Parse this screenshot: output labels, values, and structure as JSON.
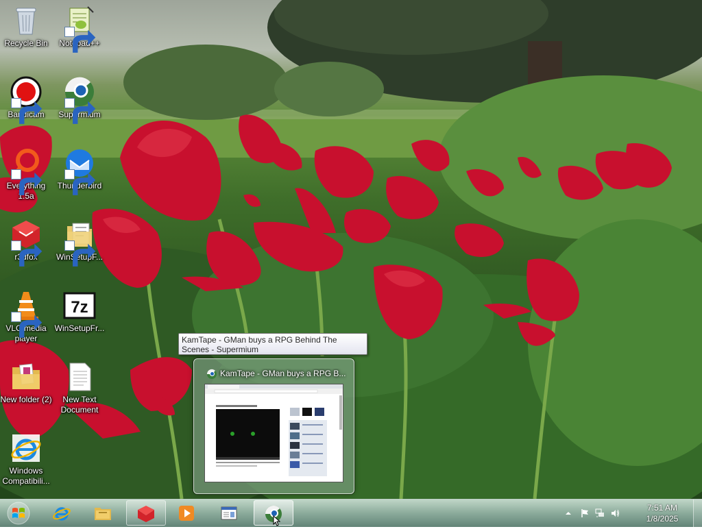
{
  "desktop": {
    "icons": [
      {
        "label": "Recycle Bin",
        "icon": "recycle-bin-icon"
      },
      {
        "label": "Notepad++",
        "icon": "notepad-plus-plus-icon"
      },
      {
        "label": "Bandicam",
        "icon": "bandicam-icon"
      },
      {
        "label": "Supermium",
        "icon": "supermium-icon"
      },
      {
        "label": "Everything 1.5a",
        "icon": "everything-icon"
      },
      {
        "label": "Thunderbird",
        "icon": "thunderbird-icon"
      },
      {
        "label": "r3dfox",
        "icon": "r3dfox-icon"
      },
      {
        "label": "WinSetupF...",
        "icon": "winsetup-folder-icon"
      },
      {
        "label": "VLC media player",
        "icon": "vlc-icon"
      },
      {
        "label": "WinSetupFr...",
        "icon": "7zip-archive-icon"
      },
      {
        "label": "New folder (2)",
        "icon": "folder-icon"
      },
      {
        "label": "New Text Document",
        "icon": "text-document-icon"
      },
      {
        "label": "Windows Compatibili...",
        "icon": "internet-explorer-icon"
      }
    ]
  },
  "tooltip": {
    "text": "KamTape - GMan buys a RPG Behind The Scenes - Supermium"
  },
  "thumbnail": {
    "title": "KamTape - GMan buys a RPG B..."
  },
  "taskbar": {
    "buttons": [
      {
        "name": "internet-explorer",
        "icon": "internet-explorer-icon",
        "state": "pinned"
      },
      {
        "name": "file-explorer",
        "icon": "folder-icon",
        "state": "pinned"
      },
      {
        "name": "r3dfox",
        "icon": "r3dfox-icon",
        "state": "open"
      },
      {
        "name": "media-player",
        "icon": "media-player-icon",
        "state": "pinned"
      },
      {
        "name": "control-panel",
        "icon": "window-icon",
        "state": "pinned"
      },
      {
        "name": "supermium",
        "icon": "supermium-icon",
        "state": "active"
      }
    ],
    "tray_icons": [
      "chevron-up-icon",
      "flag-icon",
      "network-icon",
      "volume-icon"
    ],
    "clock": {
      "time": "7:51 AM",
      "date": "1/8/2025"
    }
  },
  "colors": {
    "accent_red": "#c8102e",
    "glass": "#6e9682"
  }
}
